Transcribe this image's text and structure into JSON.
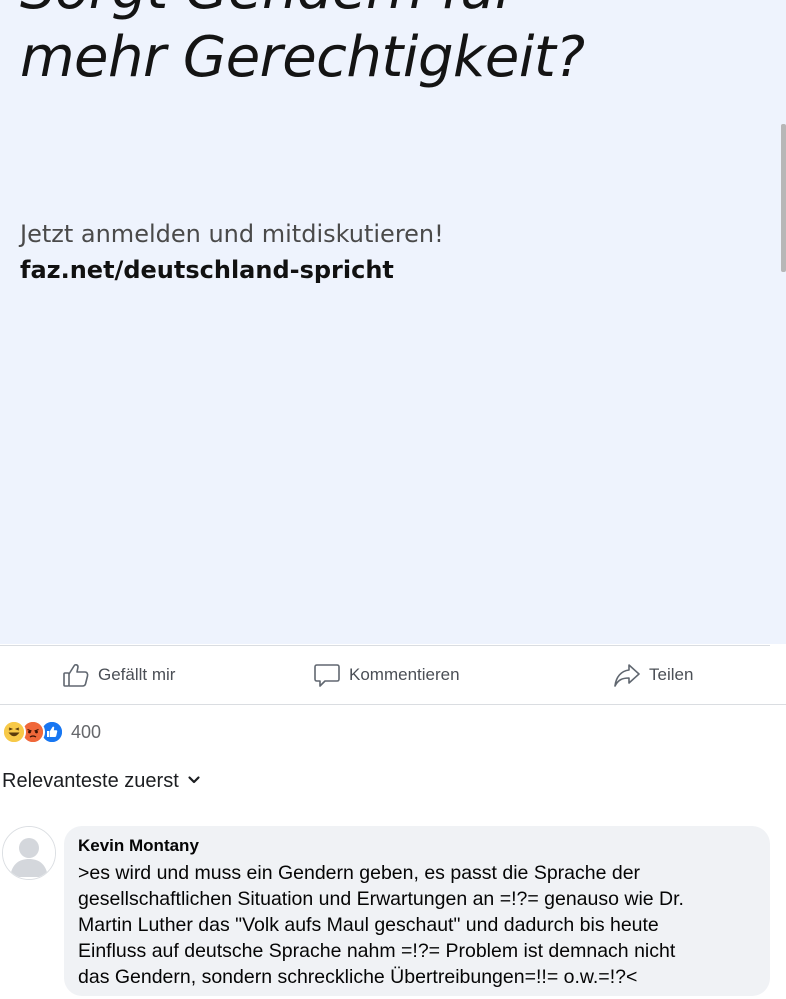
{
  "post_image": {
    "headline_lines": [
      "Sorgt Gendern für",
      "mehr Gerechtigkeit?"
    ],
    "cta": "Jetzt anmelden und mitdiskutieren!",
    "url": "faz.net/deutschland-spricht",
    "background": "#eef3fd"
  },
  "actions": {
    "like_label": "Gefällt mir",
    "comment_label": "Kommentieren",
    "share_label": "Teilen",
    "like_icon": "thumbs-up-icon",
    "comment_icon": "speech-bubble-icon",
    "share_icon": "share-arrow-icon"
  },
  "reactions": {
    "icons": [
      "haha-reaction-icon",
      "angry-reaction-icon",
      "like-reaction-icon"
    ],
    "count": "400"
  },
  "sort": {
    "label": "Relevanteste zuerst",
    "icon": "chevron-down-icon"
  },
  "comment": {
    "author": "Kevin Montany",
    "text": ">es wird und muss ein Gendern geben, es passt die Sprache der\ngesellschaftlichen Situation und Erwartungen an =!?= genauso wie Dr.\nMartin Luther das \"Volk aufs Maul geschaut\"  und dadurch bis heute\nEinfluss auf deutsche Sprache nahm =!?= Problem ist demnach nicht\ndas Gendern, sondern schreckliche Übertreibungen=!!= o.w.=!?<"
  },
  "colors": {
    "accent": "#1877f2",
    "muted_text": "#65676b",
    "bubble": "#f0f2f5"
  }
}
